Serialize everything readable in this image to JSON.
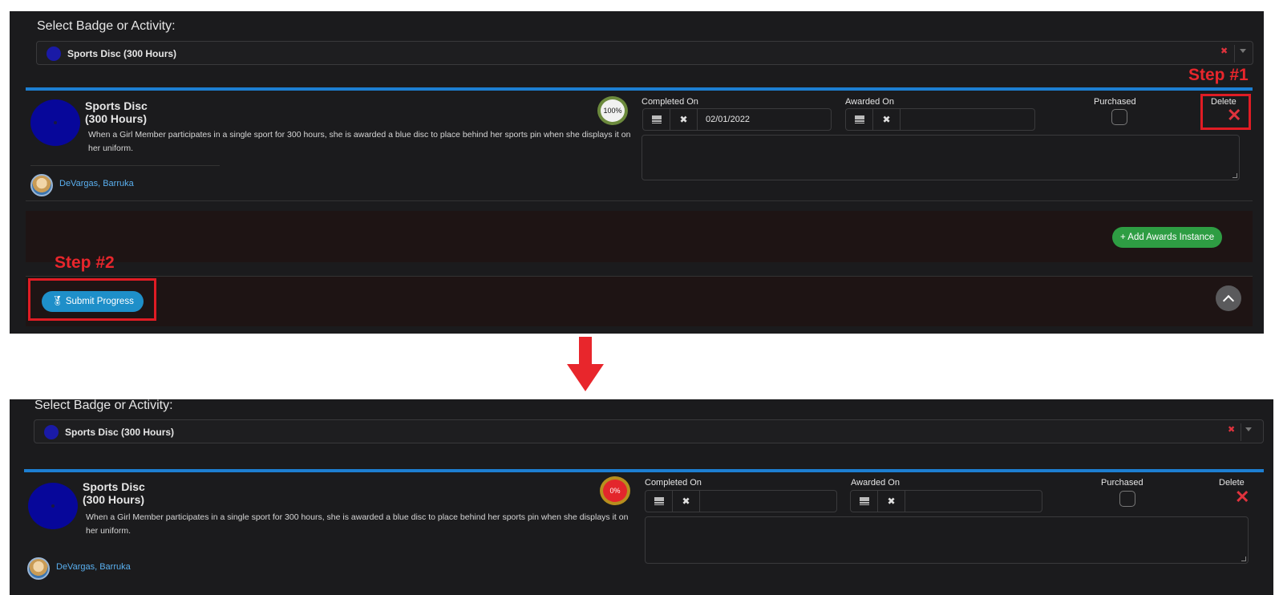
{
  "select_label": "Select Badge or Activity:",
  "selected_badge": "Sports Disc (300 Hours)",
  "badge": {
    "title_line1": "Sports Disc",
    "title_line2": "(300 Hours)",
    "description": "When a Girl Member participates in a single sport for 300 hours, she is awarded a blue disc to place behind her sports pin when she displays it on her uniform.",
    "member": "DeVargas, Barruka",
    "color": "#07079a"
  },
  "columns": {
    "completed_on": "Completed On",
    "awarded_on": "Awarded On",
    "purchased": "Purchased",
    "delete": "Delete"
  },
  "before": {
    "progress": "100%",
    "completed_date": "02/01/2022",
    "awarded_date": ""
  },
  "after": {
    "progress": "0%",
    "completed_date": "",
    "awarded_date": ""
  },
  "buttons": {
    "add_awards": "+ Add Awards Instance",
    "submit_progress": "Submit Progress"
  },
  "annotations": {
    "step1": "Step #1",
    "step2": "Step #2"
  },
  "colors": {
    "accent_blue": "#1d7fd2",
    "delete_red": "#e0333d",
    "add_green": "#2e9d43",
    "submit_blue": "#1e8fc9",
    "annotation_red": "#e01c24"
  }
}
